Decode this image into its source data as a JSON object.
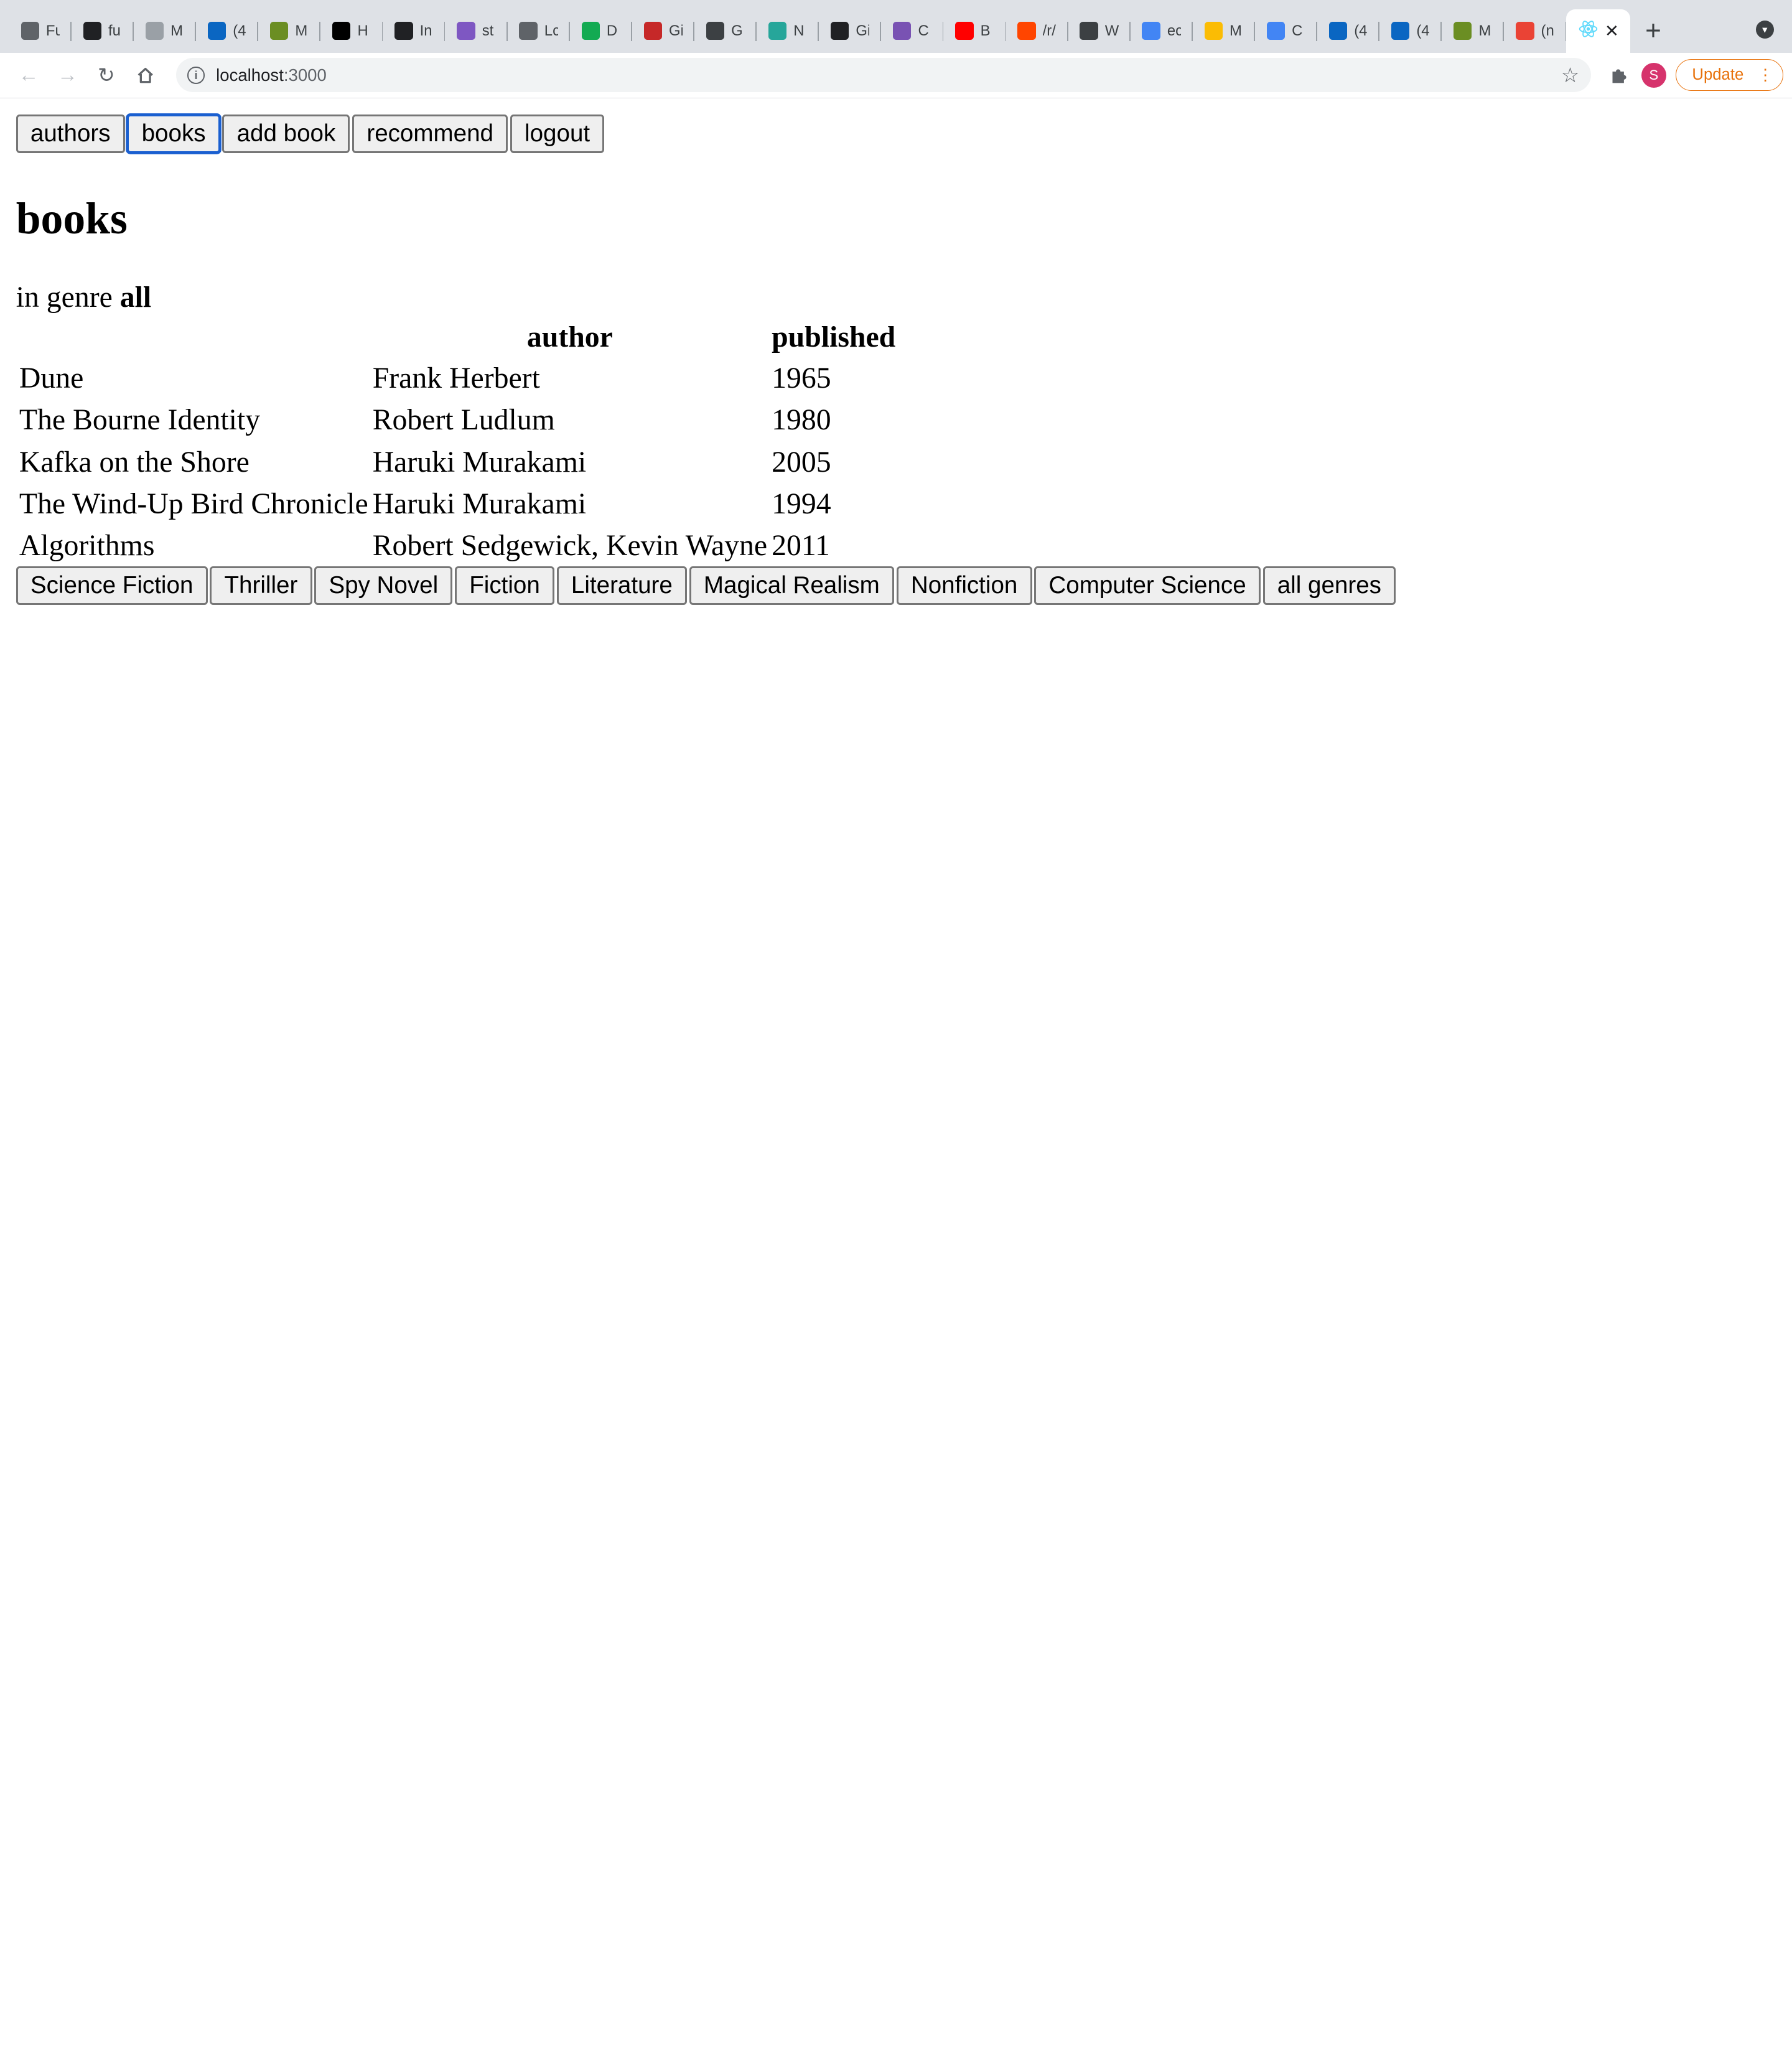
{
  "browser": {
    "tabs": [
      {
        "icon": "square-icon",
        "title": "Fu",
        "color": "#5f6368"
      },
      {
        "icon": "github-icon",
        "title": "fu",
        "color": "#202124"
      },
      {
        "icon": "circle-icon",
        "title": "M",
        "color": "#9aa0a6"
      },
      {
        "icon": "linkedin-icon",
        "title": "(4",
        "color": "#0a66c2"
      },
      {
        "icon": "plant-icon",
        "title": "M",
        "color": "#6b8e23"
      },
      {
        "icon": "medium-icon",
        "title": "H",
        "color": "#000000"
      },
      {
        "icon": "trello-icon",
        "title": "In",
        "color": "#202124"
      },
      {
        "icon": "h-icon",
        "title": "st",
        "color": "#7e57c2"
      },
      {
        "icon": "gear-icon",
        "title": "Lc",
        "color": "#5f6368"
      },
      {
        "icon": "leaf-icon",
        "title": "D",
        "color": "#13aa52"
      },
      {
        "icon": "bug-icon",
        "title": "Gi",
        "color": "#c62828"
      },
      {
        "icon": "globe-icon",
        "title": "G",
        "color": "#3c4043"
      },
      {
        "icon": "diamond-icon",
        "title": "N",
        "color": "#26a69a"
      },
      {
        "icon": "github-icon",
        "title": "Gi",
        "color": "#202124"
      },
      {
        "icon": "bootstrap-icon",
        "title": "C",
        "color": "#7952b3"
      },
      {
        "icon": "youtube-icon",
        "title": "B",
        "color": "#ff0000"
      },
      {
        "icon": "reddit-icon",
        "title": "/r/",
        "color": "#ff4500"
      },
      {
        "icon": "globe-icon",
        "title": "W",
        "color": "#3c4043"
      },
      {
        "icon": "google-icon",
        "title": "ec",
        "color": "#4285f4"
      },
      {
        "icon": "drive-icon",
        "title": "M",
        "color": "#fbbc04"
      },
      {
        "icon": "docs-icon",
        "title": "C",
        "color": "#4285f4"
      },
      {
        "icon": "linkedin-icon",
        "title": "(4",
        "color": "#0a66c2"
      },
      {
        "icon": "linkedin-icon",
        "title": "(4",
        "color": "#0a66c2"
      },
      {
        "icon": "plant-icon",
        "title": "M",
        "color": "#6b8e23"
      },
      {
        "icon": "gmail-icon",
        "title": "(n",
        "color": "#ea4335"
      }
    ],
    "active_tab": {
      "icon": "react-icon",
      "color": "#61dafb",
      "close": "✕"
    },
    "url_host": "localhost",
    "url_port": ":3000",
    "update_label": "Update"
  },
  "nav": {
    "authors": "authors",
    "books": "books",
    "add_book": "add book",
    "recommend": "recommend",
    "logout": "logout"
  },
  "page": {
    "title": "books",
    "genre_prefix": "in genre",
    "genre_value": "all"
  },
  "table": {
    "headers": [
      "",
      "author",
      "published"
    ],
    "rows": [
      [
        "Dune",
        "Frank Herbert",
        "1965"
      ],
      [
        "The Bourne Identity",
        "Robert Ludlum",
        "1980"
      ],
      [
        "Kafka on the Shore",
        "Haruki Murakami",
        "2005"
      ],
      [
        "The Wind-Up Bird Chronicle",
        "Haruki Murakami",
        "1994"
      ],
      [
        "Algorithms",
        "Robert Sedgewick, Kevin Wayne",
        "2011"
      ]
    ]
  },
  "genres": [
    "Science Fiction",
    "Thriller",
    "Spy Novel",
    "Fiction",
    "Literature",
    "Magical Realism",
    "Nonfiction",
    "Computer Science",
    "all genres"
  ]
}
